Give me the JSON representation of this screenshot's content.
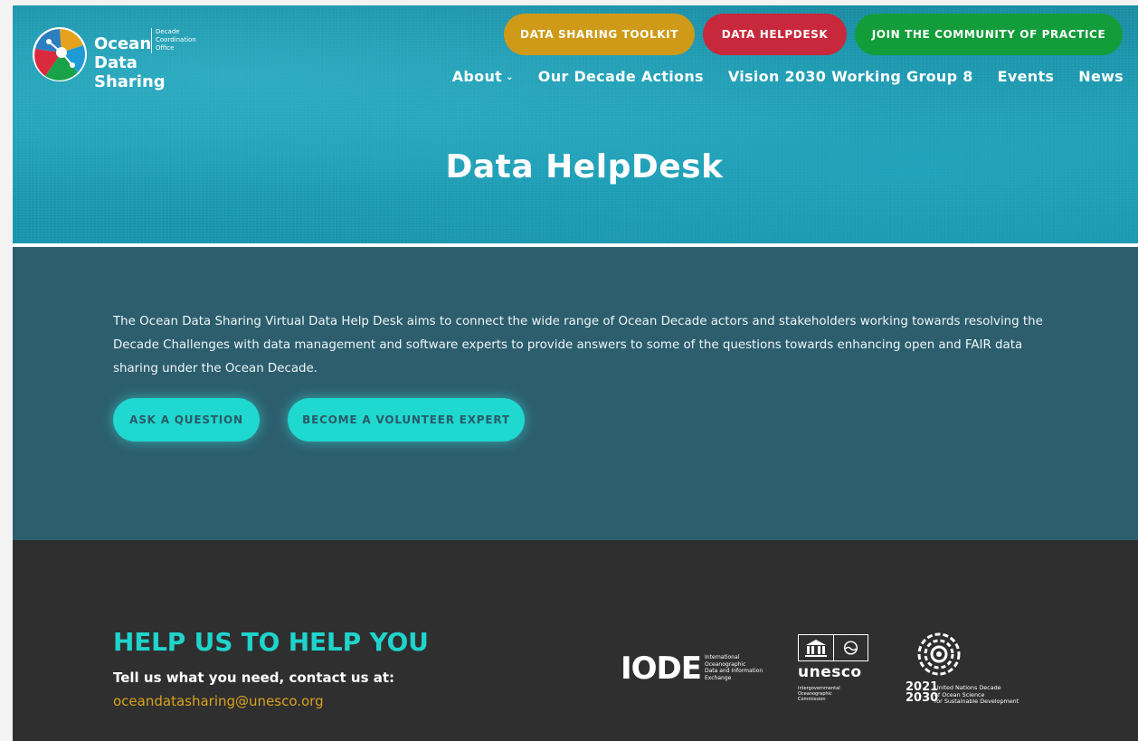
{
  "header": {
    "logo": {
      "line1": "Ocean",
      "line2": "Data Sharing",
      "sub": [
        "Decade",
        "Coordination",
        "Office"
      ]
    },
    "cta": {
      "toolkit": "DATA SHARING TOOLKIT",
      "helpdesk": "DATA HELPDESK",
      "community": "JOIN THE COMMUNITY OF PRACTICE"
    },
    "nav": [
      {
        "label": "About",
        "has_dropdown": true
      },
      {
        "label": "Our Decade Actions"
      },
      {
        "label": "Vision 2030 Working Group 8"
      },
      {
        "label": "Events"
      },
      {
        "label": "News"
      }
    ],
    "title": "Data HelpDesk"
  },
  "intro": {
    "text": "The Ocean Data Sharing Virtual Data Help Desk aims to connect the wide range of Ocean Decade actors and stakeholders working towards resolving the Decade Challenges with data management and software experts to provide answers to some of the questions towards enhancing open and FAIR data sharing under the Ocean Decade.",
    "buttons": {
      "ask": "ASK A QUESTION",
      "volunteer": "BECOME A VOLUNTEER EXPERT"
    }
  },
  "footer": {
    "title": "HELP US TO HELP YOU",
    "subtitle": "Tell us what you need, contact us at:",
    "email": "oceandatasharing@unesco.org",
    "partners": {
      "iode": {
        "name": "IODE",
        "sub": [
          "International",
          "Oceanographic",
          "Data and Information",
          "Exchange"
        ]
      },
      "unesco": {
        "name": "unesco",
        "sub": [
          "Intergovernmental",
          "Oceanographic",
          "Commission"
        ]
      },
      "decade": {
        "years": [
          "2021",
          "2030"
        ],
        "sub": [
          "United Nations Decade",
          "of Ocean Science",
          "for Sustainable Development"
        ]
      }
    }
  },
  "colors": {
    "toolkit": "#cf9a17",
    "helpdesk": "#c8283c",
    "community": "#139d3a",
    "accent_teal": "#1fd8cf",
    "email": "#d9a21a"
  }
}
